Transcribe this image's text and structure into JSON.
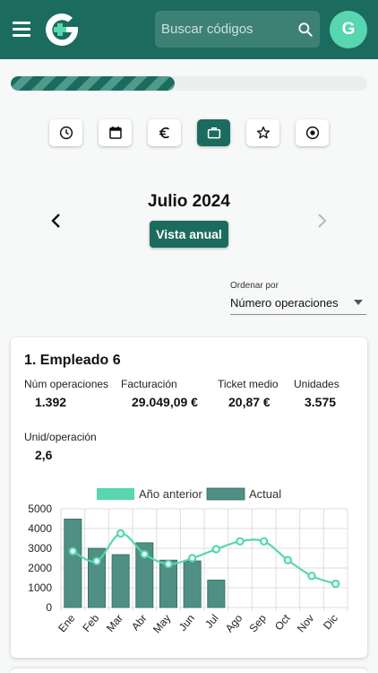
{
  "header": {
    "search_placeholder": "Buscar códigos",
    "avatar_letter": "G"
  },
  "progress": {
    "fraction": 0.46
  },
  "tabs": [
    {
      "icon": "clock-icon",
      "active": false
    },
    {
      "icon": "calendar-icon",
      "active": false
    },
    {
      "icon": "euro-icon",
      "active": false
    },
    {
      "icon": "briefcase-icon",
      "active": true
    },
    {
      "icon": "star-icon",
      "active": false
    },
    {
      "icon": "record-icon",
      "active": false
    }
  ],
  "period": {
    "month_label": "Julio 2024",
    "annual_button": "Vista anual"
  },
  "sort": {
    "label": "Ordenar por",
    "value": "Número operaciones"
  },
  "card": {
    "title": "1. Empleado 6",
    "stats": {
      "ops_label": "Núm operaciones",
      "ops_value": "1.392",
      "billing_label": "Facturación",
      "billing_value": "29.049,09 €",
      "ticket_label": "Ticket medio",
      "ticket_value": "20,87 €",
      "units_label": "Unidades",
      "units_value": "3.575",
      "unitop_label": "Unid/operación",
      "unitop_value": "2,6"
    }
  },
  "colors": {
    "primary": "#1c6b5f",
    "bar": "#4f8f84",
    "line": "#57d6b0"
  },
  "chart_data": {
    "type": "bar",
    "categories": [
      "Ene",
      "Feb",
      "Mar",
      "Abr",
      "May",
      "Jun",
      "Jul",
      "Ago",
      "Sep",
      "Oct",
      "Nov",
      "Dic"
    ],
    "series": [
      {
        "name": "Año anterior",
        "type": "line",
        "values": [
          2850,
          2350,
          3750,
          2700,
          2200,
          2500,
          2950,
          3350,
          3350,
          2400,
          1600,
          1200
        ]
      },
      {
        "name": "Actual",
        "type": "bar",
        "values": [
          4480,
          3000,
          2680,
          3280,
          2400,
          2360,
          1390,
          null,
          null,
          null,
          null,
          null
        ]
      }
    ],
    "ylim": [
      0,
      5000
    ],
    "yticks": [
      "0",
      "1000",
      "2000",
      "3000",
      "4000",
      "5000"
    ],
    "grid": true,
    "legend": "top"
  }
}
